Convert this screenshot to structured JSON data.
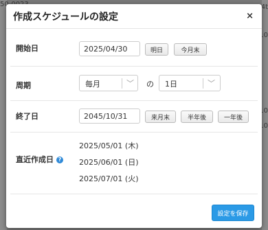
{
  "background": {
    "fragments": [
      "50-0023",
      "4t",
      "10",
      "10",
      "10"
    ]
  },
  "modal": {
    "title": "作成スケジュールの設定",
    "close_label": "×",
    "start": {
      "label": "開始日",
      "value": "2025/04/30",
      "tomorrow_btn": "明日",
      "month_end_btn": "今月末"
    },
    "cycle": {
      "label": "周期",
      "period_value": "毎月",
      "connector": "の",
      "day_value": "1日"
    },
    "end": {
      "label": "終了日",
      "value": "2045/10/31",
      "next_month_end_btn": "来月末",
      "half_year_btn": "半年後",
      "one_year_btn": "一年後"
    },
    "upcoming": {
      "label": "直近作成日",
      "help_icon": "?",
      "dates": [
        "2025/05/01 (木)",
        "2025/06/01 (日)",
        "2025/07/01 (火)"
      ]
    },
    "save_button": "設定を保存"
  }
}
